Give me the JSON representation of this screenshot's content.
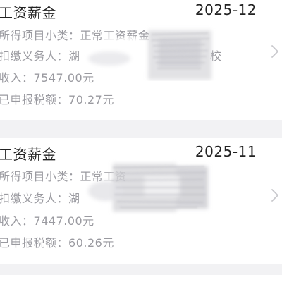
{
  "records": [
    {
      "title": "工资薪金",
      "period": "2025-12",
      "subcategory_label": "所得项目小类：",
      "subcategory_value": "正常工资薪金",
      "withholder_label": "扣缴义务人：",
      "withholder_value": "湖",
      "withholder_tail": "校",
      "income_label": "收入：",
      "income_value": "7547.00元",
      "tax_label": "已申报税额：",
      "tax_value": "70.27元"
    },
    {
      "title": "工资薪金",
      "period": "2025-11",
      "subcategory_label": "所得项目小类：",
      "subcategory_value": "正常工资",
      "withholder_label": "扣缴义务人：",
      "withholder_value": "湖",
      "withholder_tail": "",
      "income_label": "收入：",
      "income_value": "7447.00元",
      "tax_label": "已申报税额：",
      "tax_value": "60.26元"
    }
  ],
  "icons": {
    "chevron": "chevron-right-icon"
  },
  "colors": {
    "background": "#f2f2f4",
    "card": "#ffffff",
    "title_text": "#222222",
    "secondary_text": "#9a9aa0",
    "chevron": "#c8c8cc"
  }
}
